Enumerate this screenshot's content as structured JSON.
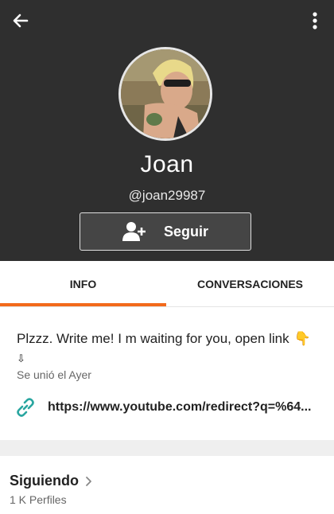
{
  "header": {
    "name": "Joan",
    "handle": "@joan29987",
    "follow_label": "Seguir"
  },
  "tabs": [
    {
      "label": "INFO",
      "active": true
    },
    {
      "label": "CONVERSACIONES",
      "active": false
    }
  ],
  "about": {
    "bio": "Plzzz. Write me! I m waiting for you, open link",
    "bio_emoji": "👇",
    "bio_arrow": "⇩",
    "joined": "Se unió el Ayer",
    "link": "https://www.youtube.com/redirect?q=%64..."
  },
  "following": {
    "title": "Siguiendo",
    "count": "1 K Perfiles"
  },
  "colors": {
    "header_bg": "#2f2f2f",
    "accent": "#f26a1b",
    "link_icon": "#2aa6a0"
  }
}
